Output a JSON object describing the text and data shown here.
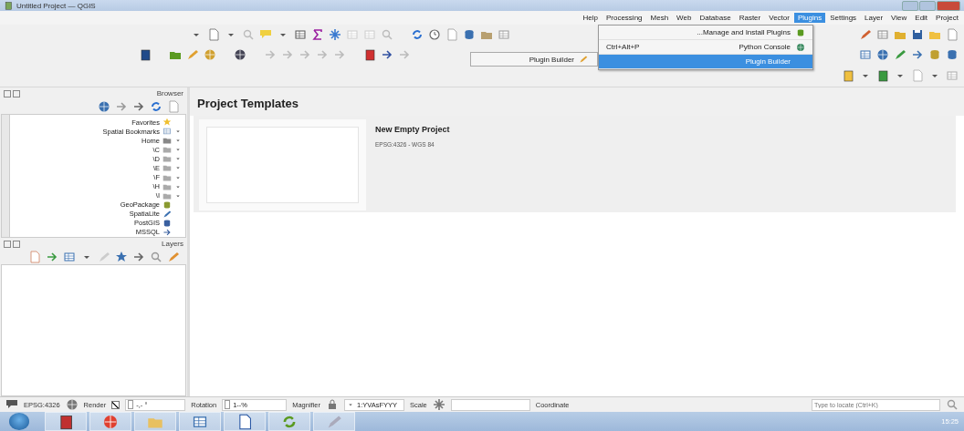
{
  "window": {
    "title": "Untitled Project — QGIS"
  },
  "menu_bar": [
    {
      "label": "Help",
      "selected": false
    },
    {
      "label": "Processing",
      "selected": false
    },
    {
      "label": "Mesh",
      "selected": false
    },
    {
      "label": "Web",
      "selected": false
    },
    {
      "label": "Database",
      "selected": false
    },
    {
      "label": "Raster",
      "selected": false
    },
    {
      "label": "Vector",
      "selected": false
    },
    {
      "label": "Plugins",
      "selected": true
    },
    {
      "label": "Settings",
      "selected": false
    },
    {
      "label": "Layer",
      "selected": false
    },
    {
      "label": "View",
      "selected": false
    },
    {
      "label": "Edit",
      "selected": false
    },
    {
      "label": "Project",
      "selected": false
    }
  ],
  "plugins_menu": [
    {
      "label": "...Manage and Install Plugins",
      "selected": false
    },
    {
      "label": "Python Console",
      "shortcut": "Ctrl+Alt+P",
      "selected": false
    },
    {
      "label": "Plugin Builder",
      "selected": true
    }
  ],
  "plugin_builder_submenu": [
    {
      "label": "Plugin Builder"
    }
  ],
  "browser_panel": {
    "title": "Browser",
    "items": [
      {
        "label": "Favorites",
        "expandable": false
      },
      {
        "label": "Spatial Bookmarks",
        "expandable": true
      },
      {
        "label": "Home",
        "expandable": true
      },
      {
        "label": "\\C",
        "expandable": true
      },
      {
        "label": "\\D",
        "expandable": true
      },
      {
        "label": "\\E",
        "expandable": true
      },
      {
        "label": "\\F",
        "expandable": true
      },
      {
        "label": "\\H",
        "expandable": true
      },
      {
        "label": "\\I",
        "expandable": true
      },
      {
        "label": "GeoPackage",
        "expandable": false
      },
      {
        "label": "SpatiaLite",
        "expandable": false
      },
      {
        "label": "PostGIS",
        "expandable": false
      },
      {
        "label": "MSSQL",
        "expandable": false
      }
    ]
  },
  "layers_panel": {
    "title": "Layers"
  },
  "project_templates": {
    "heading": "Project Templates",
    "templates": [
      {
        "name": "New Empty Project",
        "crs": "EPSG:4326 - WGS 84"
      }
    ]
  },
  "status_bar": {
    "crs": "EPSG:4326",
    "render_label": "Render",
    "render_checked": true,
    "rotation_value": "-,- °",
    "rotation_label": "Rotation",
    "magnifier_value": "1--%",
    "magnifier_label": "Magnifier",
    "scale_value": "1:YVAsFYYY",
    "scale_label": "Scale",
    "coordinate_label": "Coordinate",
    "locator_placeholder": "Type to locate (Ctrl+K)"
  },
  "taskbar": {
    "clock": "15:25"
  }
}
